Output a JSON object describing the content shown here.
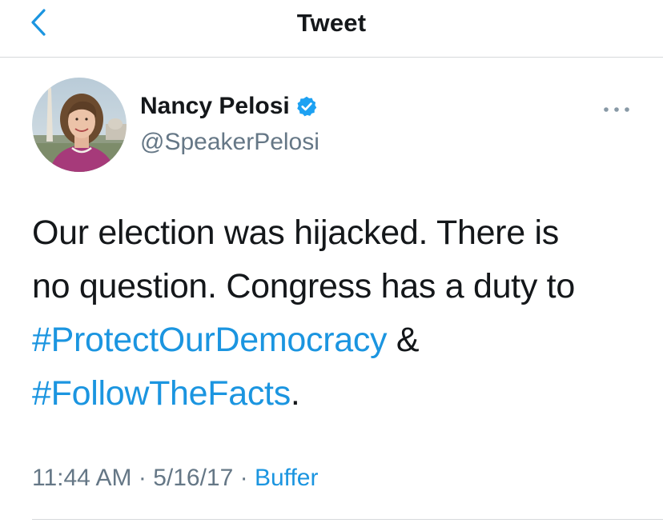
{
  "colors": {
    "accent": "#1b95e0",
    "text_primary": "#14171a",
    "text_secondary": "#657786",
    "divider": "#d6d9db"
  },
  "nav": {
    "back_icon": "chevron-left-icon",
    "title": "Tweet"
  },
  "tweet": {
    "author": {
      "name": "Nancy Pelosi",
      "handle": "@SpeakerPelosi",
      "verified": true,
      "verified_icon": "verified-badge-icon",
      "avatar_icon": "avatar-photo"
    },
    "more_icon": "more-dots-icon",
    "text": {
      "line1": "Our election was hijacked. There is",
      "line2": "no question. Congress has a duty to",
      "hashtag1": "#ProtectOurDemocracy",
      "connector": " &",
      "hashtag2": "#FollowTheFacts",
      "ending": "."
    },
    "meta": {
      "time": "11:44 AM",
      "separator1": " · ",
      "date": "5/16/17",
      "separator2": " · ",
      "source": "Buffer"
    }
  }
}
